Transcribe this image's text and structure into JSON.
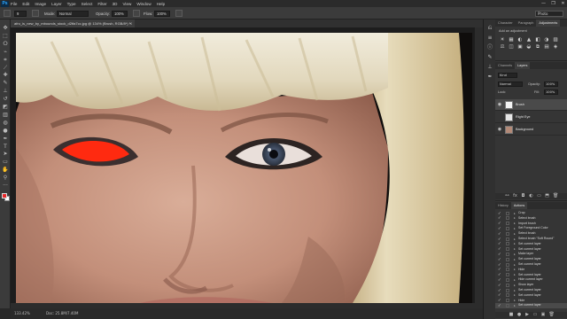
{
  "app": {
    "logo": "Ps"
  },
  "menu": [
    "File",
    "Edit",
    "Image",
    "Layer",
    "Type",
    "Select",
    "Filter",
    "3D",
    "View",
    "Window",
    "Help"
  ],
  "window_controls": {
    "minimize": "—",
    "maximize": "❐",
    "close": "✕"
  },
  "options": {
    "brush_size": "9",
    "mode_label": "Mode:",
    "mode_value": "Normal",
    "opacity_label": "Opacity:",
    "opacity_value": "100%",
    "flow_label": "Flow:",
    "flow_value": "100%",
    "workspace": "Photo"
  },
  "document": {
    "tab_title": "afro_is_new_by_mbounds_stock_d2tfa7cc.jpg @ 134% (Brush, RGB/8*) *",
    "tab_close": "×",
    "zoom": "133.42%",
    "doc_info": "Doc: 25.8M/7.40M"
  },
  "tools": [
    {
      "name": "move-tool",
      "glyph": "✥"
    },
    {
      "name": "marquee-tool",
      "glyph": "⬚"
    },
    {
      "name": "lasso-tool",
      "glyph": "ⵔ"
    },
    {
      "name": "quick-select-tool",
      "glyph": "⌁"
    },
    {
      "name": "crop-tool",
      "glyph": "⌗"
    },
    {
      "name": "eyedropper-tool",
      "glyph": "⟋"
    },
    {
      "name": "healing-brush-tool",
      "glyph": "✚"
    },
    {
      "name": "brush-tool",
      "glyph": "✎"
    },
    {
      "name": "clone-stamp-tool",
      "glyph": "⊥"
    },
    {
      "name": "history-brush-tool",
      "glyph": "↺"
    },
    {
      "name": "eraser-tool",
      "glyph": "◩"
    },
    {
      "name": "gradient-tool",
      "glyph": "▥"
    },
    {
      "name": "blur-tool",
      "glyph": "◍"
    },
    {
      "name": "dodge-tool",
      "glyph": "●"
    },
    {
      "name": "pen-tool",
      "glyph": "✒"
    },
    {
      "name": "type-tool",
      "glyph": "T"
    },
    {
      "name": "path-select-tool",
      "glyph": "➤"
    },
    {
      "name": "rectangle-tool",
      "glyph": "▭"
    },
    {
      "name": "hand-tool",
      "glyph": "✋"
    },
    {
      "name": "zoom-tool",
      "glyph": "⚲"
    },
    {
      "name": "more-tools",
      "glyph": "···"
    }
  ],
  "colors": {
    "foreground": "#e8282a",
    "background": "#ffffff",
    "accent": "#31a8ff",
    "red_eye_fill": "#ff2a10"
  },
  "strip_icons": [
    {
      "name": "history-panel-icon",
      "glyph": "⎌"
    },
    {
      "name": "properties-panel-icon",
      "glyph": "≡"
    },
    {
      "name": "info-panel-icon",
      "glyph": "ⓘ"
    },
    {
      "name": "brush-panel-icon",
      "glyph": "✎"
    },
    {
      "name": "clone-panel-icon",
      "glyph": "⊥"
    },
    {
      "name": "paths-panel-icon",
      "glyph": "✒"
    }
  ],
  "top_panel": {
    "tabs": [
      "Character",
      "Paragraph",
      "Adjustments"
    ],
    "active": 2,
    "hint": "Add an adjustment"
  },
  "adjustment_icons": [
    "☀",
    "▦",
    "◐",
    "▲",
    "◧",
    "◑",
    "▨",
    "⚖",
    "◫",
    "▣",
    "◒",
    "⧉",
    "▤",
    "◈"
  ],
  "layers_panel": {
    "tabs": [
      "Channels",
      "Layers"
    ],
    "active": 1,
    "kind_label": "Kind",
    "blend_mode": "Normal",
    "opacity_label": "Opacity:",
    "opacity_value": "100%",
    "lock_label": "Lock:",
    "fill_label": "Fill:",
    "fill_value": "100%",
    "layers": [
      {
        "name": "Brush",
        "visible": true,
        "thumb": "#f4f4f4"
      },
      {
        "name": "Right Eye",
        "visible": false,
        "thumb": "#e6e6e6"
      },
      {
        "name": "Background",
        "visible": true,
        "thumb": "#b38a78"
      }
    ],
    "footer_icons": [
      "⚯",
      "fx",
      "◘",
      "◐",
      "▭",
      "⬒",
      "🗑"
    ]
  },
  "actions_panel": {
    "tabs": [
      "History",
      "Actions"
    ],
    "active": 1,
    "items": [
      "Crop",
      "Select brush",
      "Import brush",
      "Set Foreground Color",
      "Select brush",
      "Select brush \"Soft Round\"",
      "Set current layer",
      "Set current layer",
      "Make layer",
      "Set current layer",
      "Set current layer",
      "Hide",
      "Set current layer",
      "Hide current layer",
      "Show layer",
      "Set current layer",
      "Set current layer",
      "Hide",
      "Set current layer"
    ],
    "footer_icons": [
      "■",
      "●",
      "▶",
      "▭",
      "▣",
      "🗑"
    ]
  }
}
